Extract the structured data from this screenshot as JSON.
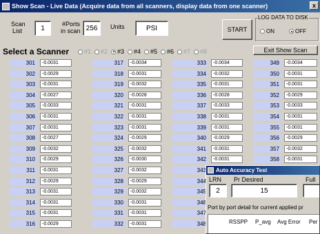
{
  "window": {
    "title": "Show Scan - Live Data  (Acquire data from all scanners, display data from one scanner)",
    "close_label": "x"
  },
  "header": {
    "scan_list_label_1": "Scan",
    "scan_list_label_2": "List",
    "scan_list_value": "1",
    "ports_label_1": "#Ports",
    "ports_label_2": "in scan",
    "ports_value": "256",
    "units_label": "Units",
    "units_value": "PSI",
    "start_label": "START",
    "exit_label": "Exit Show Scan"
  },
  "log_group": {
    "title": "LOG DATA TO DISK",
    "on_label": "ON",
    "off_label": "OFF",
    "selected": "off"
  },
  "scanner_select": {
    "title": "Select a Scanner",
    "options": [
      {
        "label": "#1",
        "enabled": false,
        "selected": false
      },
      {
        "label": "#2",
        "enabled": false,
        "selected": false
      },
      {
        "label": "#3",
        "enabled": true,
        "selected": true
      },
      {
        "label": "#4",
        "enabled": true,
        "selected": false
      },
      {
        "label": "#5",
        "enabled": true,
        "selected": false
      },
      {
        "label": "#6",
        "enabled": true,
        "selected": false
      },
      {
        "label": "#7",
        "enabled": false,
        "selected": false
      },
      {
        "label": "#8",
        "enabled": false,
        "selected": false
      }
    ]
  },
  "port_columns": [
    {
      "ports": [
        "301",
        "302",
        "303",
        "304",
        "305",
        "306",
        "307",
        "308",
        "309",
        "310",
        "311",
        "312",
        "313",
        "314",
        "315",
        "316"
      ],
      "values": [
        "-0.0031",
        "-0.0029",
        "-0.0031",
        "-0.0027",
        "-0.0033",
        "-0.0031",
        "-0.0031",
        "-0.0027",
        "-0.0032",
        "-0.0029",
        "-0.0031",
        "-0.0029",
        "-0.0031",
        "-0.0031",
        "-0.0031",
        "-0.0029"
      ]
    },
    {
      "ports": [
        "317",
        "318",
        "319",
        "320",
        "321",
        "322",
        "323",
        "324",
        "325",
        "326",
        "327",
        "328",
        "329",
        "330",
        "331",
        "332"
      ],
      "values": [
        "-0.0034",
        "-0.0031",
        "-0.0032",
        "-0.0028",
        "-0.0031",
        "-0.0031",
        "-0.0031",
        "-0.0029",
        "-0.0032",
        "-0.0030",
        "-0.0032",
        "-0.0029",
        "-0.0032",
        "-0.0031",
        "-0.0031",
        "-0.0031"
      ]
    },
    {
      "ports": [
        "333",
        "334",
        "335",
        "336",
        "337",
        "338",
        "339",
        "340",
        "341",
        "342",
        "343",
        "344",
        "345",
        "346",
        "347",
        "348"
      ],
      "values": [
        "-0.0034",
        "-0.0032",
        "-0.0031",
        "-0.0028",
        "-0.0033",
        "-0.0031",
        "-0.0031",
        "-0.0029",
        "-0.0031",
        "-0.0031",
        "",
        "",
        "",
        "",
        "",
        ""
      ]
    },
    {
      "ports": [
        "349",
        "350",
        "351",
        "352",
        "353",
        "354",
        "355",
        "356",
        "357",
        "358"
      ],
      "values": [
        "-0.0034",
        "-0.0031",
        "-0.0031",
        "-0.0029",
        "-0.0033",
        "-0.0031",
        "-0.0031",
        "-0.0029",
        "-0.0032",
        "-0.0031"
      ]
    }
  ],
  "popup": {
    "title": "Auto Accuracy Test",
    "lrn_label": "LRN",
    "lrn_value": "2",
    "pr_desired_label": "Pr Desired",
    "pr_desired_value": "15",
    "full_label": "Full S",
    "detail_text": "Port by port detail for current applied pr",
    "col_rsspp": "RSSPP",
    "col_pavg": "P_avg",
    "col_avg_error": "Avg Error",
    "col_per": "Per"
  }
}
